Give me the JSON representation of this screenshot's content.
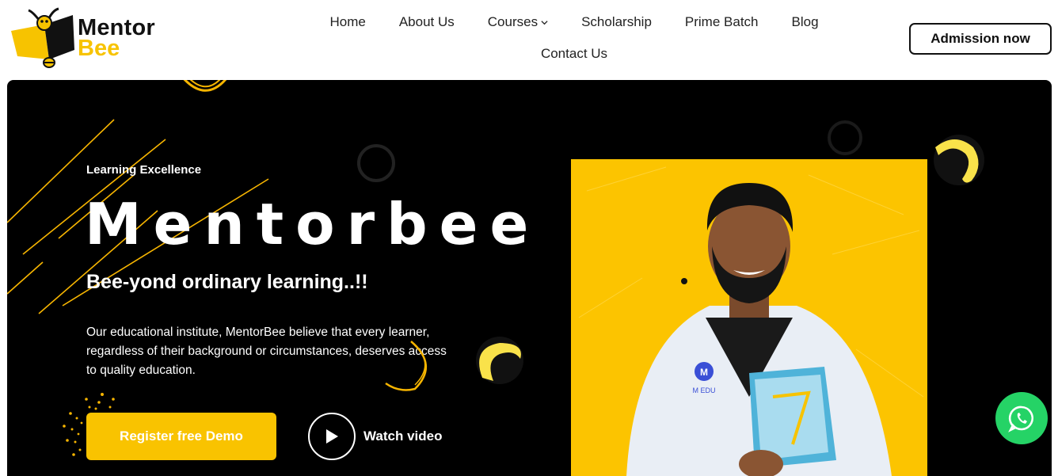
{
  "brand": {
    "name_line1": "Mentor",
    "name_line2": "Bee",
    "accent_color": "#f7c300",
    "icon": "bee-logo-icon"
  },
  "nav": {
    "items": [
      {
        "label": "Home"
      },
      {
        "label": "About Us"
      },
      {
        "label": "Courses",
        "icon": "chevron-down-icon"
      },
      {
        "label": "Scholarship"
      },
      {
        "label": "Prime Batch"
      },
      {
        "label": "Blog"
      },
      {
        "label": "Contact Us"
      }
    ]
  },
  "header": {
    "cta_label": "Admission now"
  },
  "hero": {
    "kicker": "Learning Excellence",
    "title": "Mentorbee",
    "tagline": "Bee-yond ordinary learning..!!",
    "description": "Our educational institute, MentorBee believe that every learner, regardless of their background or circumstances, deserves access to quality education.",
    "primary_cta": "Register free Demo",
    "secondary_cta": "Watch video",
    "secondary_icon": "play-icon",
    "background_color": "#000000",
    "photo_background": "#fcc400",
    "photo_badge": "M EDU"
  },
  "floating": {
    "icon": "whatsapp-icon",
    "color": "#25d366"
  }
}
